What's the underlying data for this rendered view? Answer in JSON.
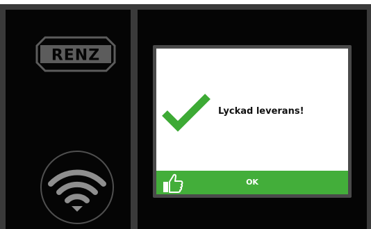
{
  "brand": {
    "logo_text": "RENZ"
  },
  "icons": {
    "wifi": "wifi-icon",
    "check": "checkmark-icon",
    "thumb": "thumbs-up-icon"
  },
  "dialog": {
    "message": "Lyckad leverans!",
    "ok_label": "OK"
  },
  "colors": {
    "accent_green": "#43ae3a",
    "check_green": "#3daa35",
    "logo_gray": "#5c5c5c",
    "frame_gray": "#3a3a3a",
    "panel_black": "#050505"
  }
}
